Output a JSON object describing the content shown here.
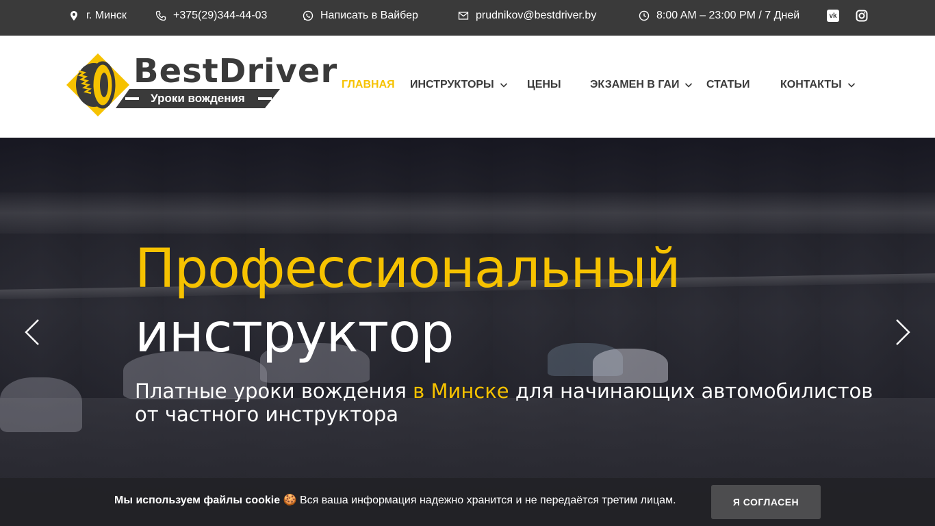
{
  "topbar": {
    "location": "г. Минск",
    "phone": "+375(29)344-44-03",
    "viber": "Написать в Вайбер",
    "email": "prudnikov@bestdriver.by",
    "hours": "8:00 AM – 23:00 PM / 7 Дней",
    "social": [
      {
        "icon": "vk-icon",
        "label": "vk"
      },
      {
        "icon": "instagram-icon",
        "label": ""
      }
    ]
  },
  "logo": {
    "title": "BestDriver",
    "subtitle": "Уроки вождения"
  },
  "nav": {
    "items": [
      {
        "label": "ГЛАВНАЯ",
        "active": true,
        "dropdown": false
      },
      {
        "label": "ИНСТРУКТОРЫ",
        "active": false,
        "dropdown": true
      },
      {
        "label": "ЦЕНЫ",
        "active": false,
        "dropdown": false
      },
      {
        "label": "ЭКЗАМЕН В ГАИ",
        "active": false,
        "dropdown": true
      },
      {
        "label": "СТАТЬИ",
        "active": false,
        "dropdown": false
      },
      {
        "label": "КОНТАКТЫ",
        "active": false,
        "dropdown": true
      }
    ]
  },
  "hero": {
    "title_line1": "Профессиональный",
    "title_line2": "инструктор",
    "subtitle_before": "Платные уроки вождения ",
    "subtitle_highlight": "в Минске",
    "subtitle_after": " для начинающих автомобилистов от частного инструктора"
  },
  "cookie": {
    "bold": "Мы используем файлы cookie",
    "emoji": "🍪",
    "text": " Вся ваша информация надежно хранится и не передаётся третим лицам.",
    "button": "Я СОГЛАСЕН"
  },
  "colors": {
    "accent": "#f6c200",
    "topbar": "#3a3a3a",
    "text_dark": "#3a3a3a"
  }
}
